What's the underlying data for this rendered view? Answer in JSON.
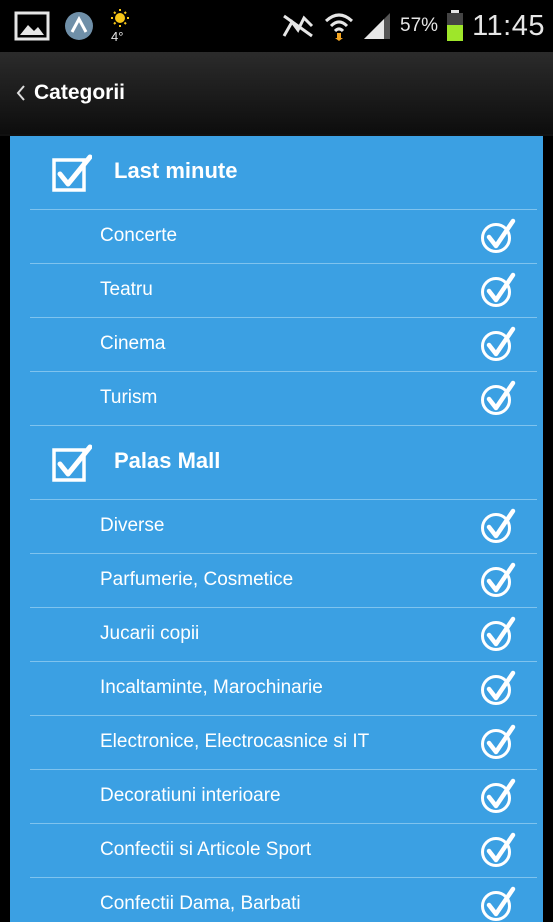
{
  "status_bar": {
    "battery_percent": "57%",
    "clock": "11:45",
    "weather_temp": "4°",
    "icons": [
      "gallery-icon",
      "app-notification-icon",
      "weather-sun-icon",
      "blocking-mode-icon",
      "wifi-icon",
      "signal-icon",
      "battery-icon"
    ]
  },
  "action_bar": {
    "back_label": "back-chevron-icon",
    "title": "Categorii"
  },
  "groups": [
    {
      "title": "Last minute",
      "checked": true,
      "items": [
        {
          "label": "Concerte",
          "checked": true
        },
        {
          "label": "Teatru",
          "checked": true
        },
        {
          "label": "Cinema",
          "checked": true
        },
        {
          "label": "Turism",
          "checked": true
        }
      ]
    },
    {
      "title": "Palas Mall",
      "checked": true,
      "items": [
        {
          "label": "Diverse",
          "checked": true
        },
        {
          "label": "Parfumerie, Cosmetice",
          "checked": true
        },
        {
          "label": "Jucarii copii",
          "checked": true
        },
        {
          "label": "Incaltaminte, Marochinarie",
          "checked": true
        },
        {
          "label": "Electronice, Electrocasnice si IT",
          "checked": true
        },
        {
          "label": "Decoratiuni interioare",
          "checked": true
        },
        {
          "label": "Confectii si Articole Sport",
          "checked": true
        },
        {
          "label": "Confectii Dama, Barbati",
          "checked": true
        }
      ]
    }
  ],
  "colors": {
    "list_background": "#3ba0e3",
    "divider": "#7fc3ee",
    "action_bar": "#1a1a1a",
    "battery_fill": "#9ee62a"
  }
}
